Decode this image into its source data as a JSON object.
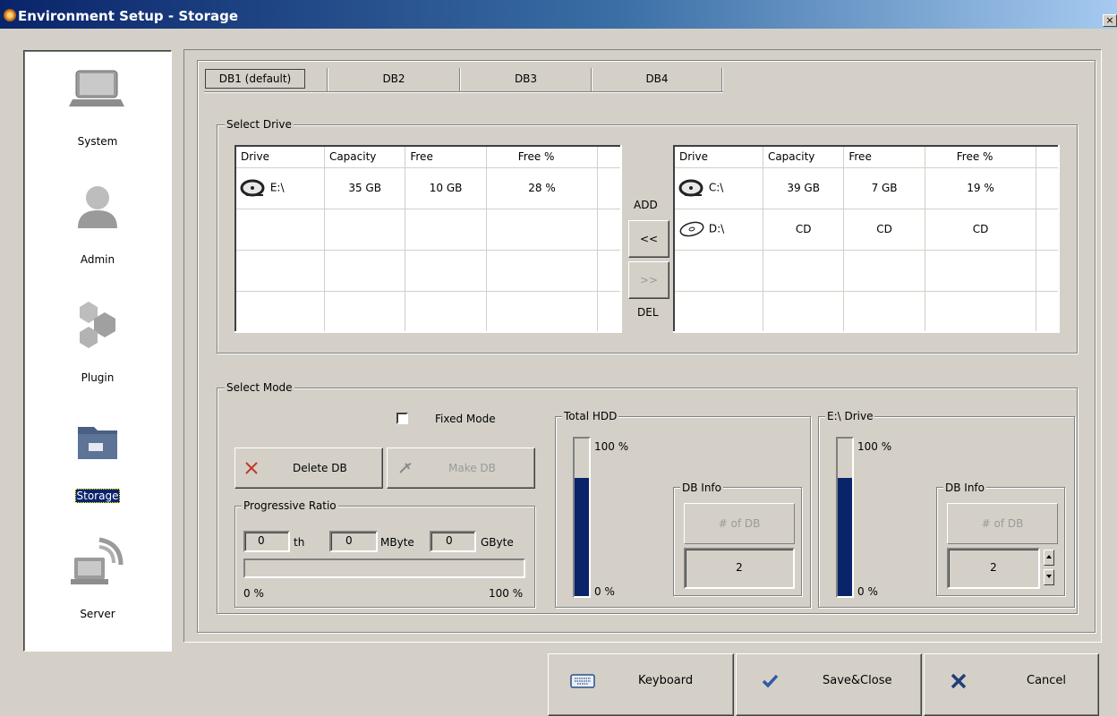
{
  "window": {
    "title": "Environment Setup - Storage",
    "close_glyph": "×"
  },
  "sidebar": {
    "items": [
      {
        "label": "System",
        "icon": "laptop-icon"
      },
      {
        "label": "Admin",
        "icon": "user-icon"
      },
      {
        "label": "Plugin",
        "icon": "hexagon-plugin-icon"
      },
      {
        "label": "Storage",
        "icon": "folder-storage-icon",
        "active": true
      },
      {
        "label": "Server",
        "icon": "satellite-server-icon"
      }
    ]
  },
  "tabs": [
    "DB1 (default)",
    "DB2",
    "DB3",
    "DB4"
  ],
  "select_drive": {
    "title": "Select Drive",
    "left_table": {
      "headers": [
        "Drive",
        "Capacity",
        "Free",
        "Free %"
      ],
      "rows": [
        {
          "drive": "E:\\",
          "capacity": "35 GB",
          "free": "10 GB",
          "free_pct": "28 %",
          "icon": "hdd-icon"
        }
      ]
    },
    "add_label": "ADD",
    "add_button": "<<",
    "del_button": ">>",
    "del_label": "DEL",
    "right_table": {
      "headers": [
        "Drive",
        "Capacity",
        "Free",
        "Free %"
      ],
      "rows": [
        {
          "drive": "C:\\",
          "capacity": "39 GB",
          "free": "7 GB",
          "free_pct": "19 %",
          "icon": "hdd-icon"
        },
        {
          "drive": "D:\\",
          "capacity": "CD",
          "free": "CD",
          "free_pct": "CD",
          "icon": "cd-icon"
        }
      ]
    }
  },
  "select_mode": {
    "title": "Select Mode",
    "fixed_mode_label": "Fixed Mode",
    "fixed_mode_checked": false,
    "delete_db_label": "Delete DB",
    "make_db_label": "Make DB",
    "progressive": {
      "title": "Progressive Ratio",
      "th_value": "0",
      "th_unit": "th",
      "mbyte_value": "0",
      "mbyte_unit": "MByte",
      "gbyte_value": "0",
      "gbyte_unit": "GByte",
      "min_label": "0 %",
      "max_label": "100 %",
      "progress": 0
    },
    "total_hdd": {
      "title": "Total HDD",
      "top_label": "100 %",
      "bottom_label": "0 %",
      "fill_fraction": 0.75,
      "db_info_title": "DB Info",
      "num_db_label": "# of DB",
      "num_db_value": "2"
    },
    "drive_panel": {
      "title": "E:\\ Drive",
      "top_label": "100 %",
      "bottom_label": "0 %",
      "fill_fraction": 0.75,
      "db_info_title": "DB Info",
      "num_db_label": "# of DB",
      "num_db_value": "2"
    }
  },
  "footer": {
    "keyboard_label": "Keyboard",
    "save_label": "Save&Close",
    "cancel_label": "Cancel"
  },
  "colors": {
    "title_bar": "#0a246a",
    "gauge_fill": "#0a246a",
    "face": "#d4d0c8"
  }
}
